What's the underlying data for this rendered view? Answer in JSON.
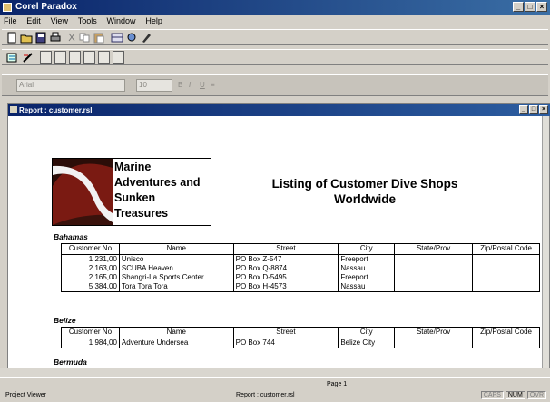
{
  "app": {
    "title": "Corel Paradox"
  },
  "menu": [
    "File",
    "Edit",
    "View",
    "Tools",
    "Window",
    "Help"
  ],
  "font_toolbar": {
    "font": "Arial",
    "size": "10"
  },
  "child_window": {
    "title": "Report : customer.rsl"
  },
  "report": {
    "logo_lines": [
      "Marine",
      "Adventures and",
      "Sunken",
      "Treasures"
    ],
    "title_lines": [
      "Listing of Customer Dive Shops",
      "Worldwide"
    ],
    "headers": [
      "Customer No",
      "Name",
      "Street",
      "City",
      "State/Prov",
      "Zip/Postal Code"
    ],
    "sections": [
      {
        "region": "Bahamas",
        "rows": [
          [
            "1 231,00",
            "Unisco",
            "PO Box Z-547",
            "Freeport",
            "",
            ""
          ],
          [
            "2 163,00",
            "SCUBA Heaven",
            "PO Box Q-8874",
            "Nassau",
            "",
            ""
          ],
          [
            "2 165,00",
            "Shangri-La Sports Center",
            "PO Box D-5495",
            "Freeport",
            "",
            ""
          ],
          [
            "5 384,00",
            "Tora Tora Tora",
            "PO Box H-4573",
            "Nassau",
            "",
            ""
          ]
        ]
      },
      {
        "region": "Belize",
        "rows": [
          [
            "1 984,00",
            "Adventure Undersea",
            "PO Box 744",
            "Belize City",
            "",
            ""
          ]
        ]
      },
      {
        "region": "Bermuda",
        "rows": []
      }
    ]
  },
  "status": {
    "page": "Page 1",
    "left": "Project Viewer",
    "middle": "Report : customer.rsl",
    "indicators": [
      "CAPS",
      "NUM",
      "OVR"
    ]
  }
}
